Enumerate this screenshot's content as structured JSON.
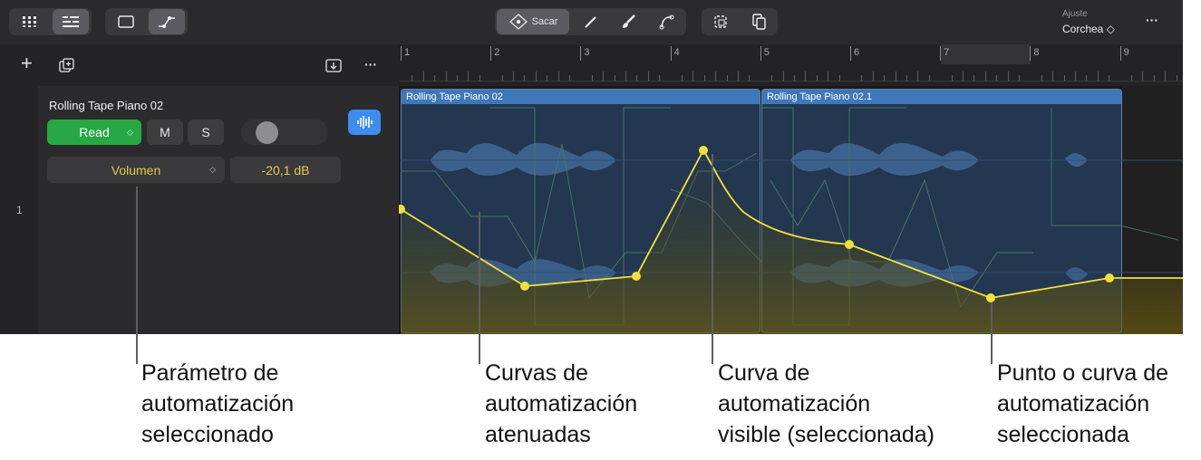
{
  "toolbar": {
    "pointer_tool_label": "Sacar",
    "snap_label": "Ajuste",
    "snap_value": "Corchea ◇",
    "more_label": "···"
  },
  "panel": {
    "add_label": "+",
    "more_label": "···"
  },
  "track": {
    "number": "1",
    "name": "Rolling Tape Piano 02",
    "automation_mode": "Read",
    "mode_chevron": "◇",
    "mute_label": "M",
    "solo_label": "S",
    "parameter": "Volumen",
    "parameter_chevron": "◇",
    "parameter_value": "-20,1 dB"
  },
  "ruler": {
    "bars": [
      "1",
      "2",
      "3",
      "4",
      "5",
      "6",
      "7",
      "8",
      "9"
    ]
  },
  "regions": [
    {
      "title": "Rolling Tape Piano 02"
    },
    {
      "title": "Rolling Tape Piano 02.1"
    }
  ],
  "colors": {
    "automation_selected": "#f2e03a",
    "mode_green": "#27a844",
    "region_header": "#3f77b8",
    "param_text": "#e5c84a"
  },
  "callouts": {
    "param": [
      "Parámetro de",
      "automatización",
      "seleccionado"
    ],
    "dimmed": [
      "Curvas de",
      "automatización",
      "atenuadas"
    ],
    "visible": [
      "Curva de",
      "automatización",
      "visible (seleccionada)"
    ],
    "point": [
      "Punto o curva de",
      "automatización",
      "seleccionada"
    ]
  }
}
